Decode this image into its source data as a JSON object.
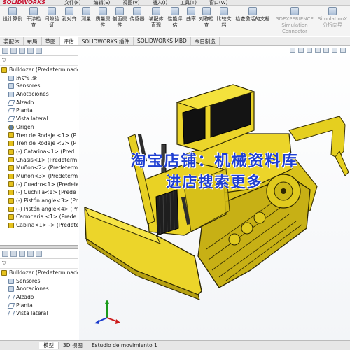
{
  "app": {
    "logo": "SOLIDWORKS",
    "menu": [
      "文件(F)",
      "编辑(E)",
      "视图(V)",
      "插入(I)",
      "工具(T)",
      "窗口(W)"
    ]
  },
  "ribbon": [
    {
      "l1": "设计算例",
      "l2": ""
    },
    {
      "l1": "干涉检",
      "l2": "查"
    },
    {
      "l1": "间隙验",
      "l2": "证"
    },
    {
      "l1": "孔对齐",
      "l2": ""
    },
    {
      "l1": "测量",
      "l2": ""
    },
    {
      "l1": "质量属",
      "l2": "性"
    },
    {
      "l1": "剖面属",
      "l2": "性"
    },
    {
      "l1": "传感器",
      "l2": ""
    },
    {
      "l1": "装配体",
      "l2": "直观"
    },
    {
      "l1": "性能评",
      "l2": "估"
    },
    {
      "l1": "曲率",
      "l2": ""
    },
    {
      "l1": "对称检",
      "l2": "查"
    },
    {
      "l1": "比较文",
      "l2": "档"
    },
    {
      "l1": "检查激活的文档",
      "l2": ""
    },
    {
      "l1": "3DEXPERIENCE",
      "l2": "Simulation Connector"
    },
    {
      "l1": "SimulationX",
      "l2": "分析向导"
    }
  ],
  "tabs": [
    "装配体",
    "布局",
    "草图",
    "评估",
    "SOLIDWORKS 插件",
    "SOLIDWORKS MBD",
    "今日制造"
  ],
  "tree": [
    {
      "t": "Bulldozer  (Predeterminado",
      "k": "asm"
    },
    {
      "t": "历史记录",
      "k": "fold"
    },
    {
      "t": "Sensores",
      "k": "fold"
    },
    {
      "t": "Anotaciones",
      "k": "fold"
    },
    {
      "t": "Alzado",
      "k": "plane"
    },
    {
      "t": "Planta",
      "k": "plane"
    },
    {
      "t": "Vista lateral",
      "k": "plane"
    },
    {
      "t": "Origen",
      "k": "pt"
    },
    {
      "t": "Tren de Rodaje <1> (P",
      "k": "part"
    },
    {
      "t": "Tren de Rodaje <2> (P",
      "k": "part"
    },
    {
      "t": "(-) Catarina<1> (Pred",
      "k": "part"
    },
    {
      "t": "Chasis<1> (Predetermi",
      "k": "part"
    },
    {
      "t": "Muñon<2> (Predeterm",
      "k": "part"
    },
    {
      "t": "Muñon<3> (Predeterm",
      "k": "part"
    },
    {
      "t": "(-) Cuadro<1> (Predete",
      "k": "part"
    },
    {
      "t": "(-) Cuchilla<1> (Prede",
      "k": "part"
    },
    {
      "t": "(-) Pistón angle<3> (Pre",
      "k": "part"
    },
    {
      "t": "(-) Pistón angle<4> (Pre",
      "k": "part"
    },
    {
      "t": "Carroceria <1> (Prede",
      "k": "part"
    },
    {
      "t": "Cabina<1> -> (Predete",
      "k": "part"
    }
  ],
  "tree2": [
    {
      "t": "Bulldozer  (Predeterminado",
      "k": "asm"
    },
    {
      "t": "Sensores",
      "k": "fold"
    },
    {
      "t": "Anotaciones",
      "k": "fold"
    },
    {
      "t": "Alzado",
      "k": "plane"
    },
    {
      "t": "Planta",
      "k": "plane"
    },
    {
      "t": "Vista lateral",
      "k": "plane"
    }
  ],
  "watermark": {
    "line1": "淘宝店铺：机械资料库",
    "line2": "进店搜索更多"
  },
  "bottom_tabs": [
    "模型",
    "3D 视图",
    "Estudio de movimiento 1"
  ]
}
